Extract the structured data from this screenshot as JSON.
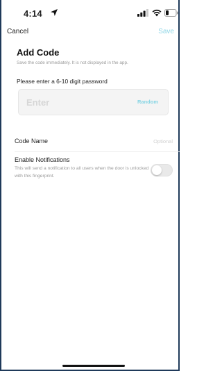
{
  "status_bar": {
    "time": "4:14",
    "location_icon": "location-arrow-icon",
    "signal_icon": "cellular-signal-icon",
    "wifi_icon": "wifi-icon",
    "battery_icon": "battery-icon"
  },
  "nav": {
    "cancel_label": "Cancel",
    "save_label": "Save",
    "save_color": "#8fd6e6"
  },
  "header": {
    "title": "Add Code",
    "subtitle": "Save the code immediately. It is not displayed in the app."
  },
  "password": {
    "prompt": "Please enter a 6-10 digit password",
    "placeholder": "Enter",
    "random_label": "Random",
    "accent_color": "#86d5e4"
  },
  "code_name": {
    "label": "Code Name",
    "placeholder": "Optional"
  },
  "notifications": {
    "title": "Enable Notifications",
    "description": "This will send a notification to all users when the door is unlocked with this fingerprint.",
    "enabled": false
  }
}
